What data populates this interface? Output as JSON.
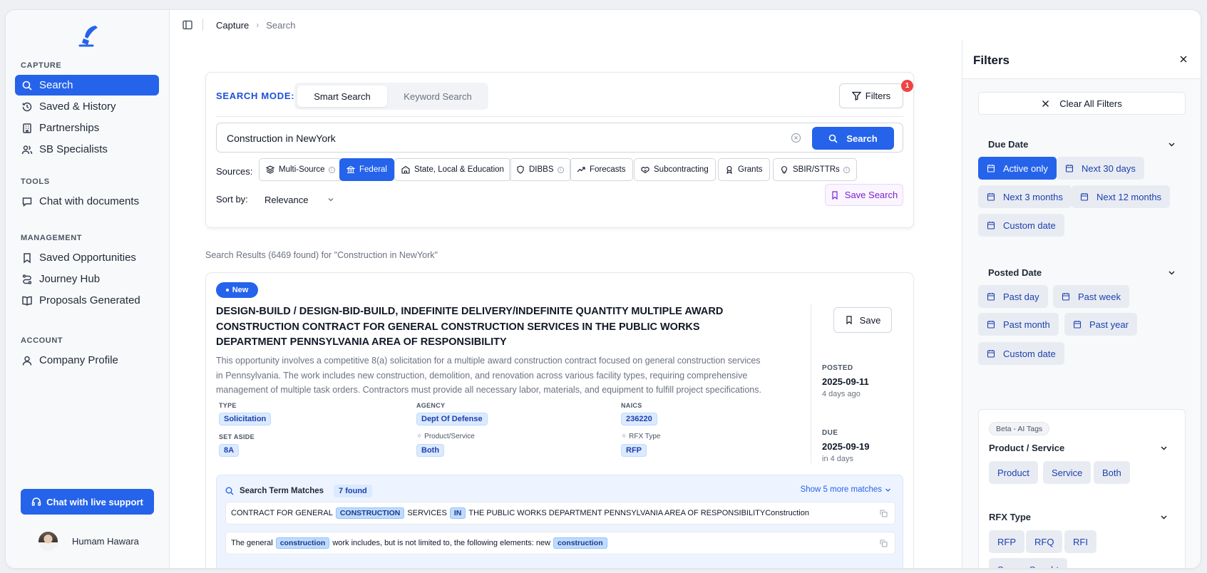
{
  "sidebar": {
    "sections": [
      {
        "title": "CAPTURE",
        "items": [
          "Search",
          "Saved & History",
          "Partnerships",
          "SB Specialists"
        ]
      },
      {
        "title": "TOOLS",
        "items": [
          "Chat with documents"
        ]
      },
      {
        "title": "MANAGEMENT",
        "items": [
          "Saved Opportunities",
          "Journey Hub",
          "Proposals Generated"
        ]
      },
      {
        "title": "ACCOUNT",
        "items": [
          "Company Profile"
        ]
      }
    ],
    "support_label": "Chat with live support",
    "user_name": "Humam Hawara"
  },
  "breadcrumb": {
    "root": "Capture",
    "current": "Search"
  },
  "search_card": {
    "mode_label": "SEARCH MODE:",
    "modes": [
      "Smart Search",
      "Keyword Search"
    ],
    "active_mode": "Smart Search",
    "filters_label": "Filters",
    "filters_count": "1",
    "query": "Construction in NewYork",
    "search_button": "Search",
    "sources_label": "Sources:",
    "sources": [
      "Multi-Source",
      "Federal",
      "State, Local & Education",
      "DIBBS",
      "Forecasts",
      "Subcontracting",
      "Grants",
      "SBIR/STTRs"
    ],
    "selected_source": "Federal",
    "sort_label": "Sort by:",
    "sort_value": "Relevance",
    "save_search_label": "Save Search"
  },
  "results": {
    "summary": "Search Results (6469 found) for \"Construction in NewYork\"",
    "items": [
      {
        "badge": "New",
        "title": "DESIGN-BUILD / DESIGN-BID-BUILD, INDEFINITE DELIVERY/INDEFINITE QUANTITY MULTIPLE AWARD CONSTRUCTION CONTRACT FOR GENERAL CONSTRUCTION SERVICES IN THE PUBLIC WORKS DEPARTMENT PENNSYLVANIA AREA OF RESPONSIBILITY",
        "description": "This opportunity involves a competitive 8(a) solicitation for a multiple award construction contract focused on general construction services in Pennsylvania. The work includes new construction, demolition, and renovation across various facility types, requiring comprehensive management of multiple task orders. Contractors must provide all necessary labor, materials, and equipment to fulfill project specifications.",
        "meta": {
          "type_label": "TYPE",
          "type": "Solicitation",
          "agency_label": "AGENCY",
          "agency": "Dept Of Defense",
          "naics_label": "NAICS",
          "naics": "236220",
          "set_aside_label": "SET ASIDE",
          "set_aside": "8A",
          "product_label": "Product/Service",
          "product": "Both",
          "rfx_label": "RFX Type",
          "rfx": "RFP"
        },
        "save_label": "Save",
        "posted_label": "POSTED",
        "posted_date": "2025-09-11",
        "posted_rel": "4 days ago",
        "due_label": "DUE",
        "due_date": "2025-09-19",
        "due_rel": "in 4 days",
        "matches": {
          "title": "Search Term Matches",
          "found": "7 found",
          "show_more": "Show 5 more matches",
          "row1": {
            "t1": "CONTRACT FOR GENERAL",
            "h1": "CONSTRUCTION",
            "t2": "SERVICES",
            "h2": "IN",
            "t3": "THE PUBLIC WORKS DEPARTMENT PENNSYLVANIA AREA OF RESPONSIBILITYConstruction"
          },
          "row2": {
            "t1": "The general",
            "h1": "construction",
            "t2": "work includes, but is not limited to, the following elements: new",
            "h2": "construction"
          }
        }
      }
    ]
  },
  "filters": {
    "title": "Filters",
    "clear_all": "Clear All Filters",
    "due_date": {
      "title": "Due Date",
      "options": [
        "Active only",
        "Next 30 days",
        "Next 3 months",
        "Next 12 months",
        "Custom date"
      ],
      "selected": "Active only"
    },
    "posted_date": {
      "title": "Posted Date",
      "options": [
        "Past day",
        "Past week",
        "Past month",
        "Past year",
        "Custom date"
      ]
    },
    "ai_tags": {
      "beta_label": "Beta - AI Tags",
      "product_service": {
        "title": "Product / Service",
        "options": [
          "Product",
          "Service",
          "Both"
        ]
      },
      "rfx_type": {
        "title": "RFX Type",
        "options": [
          "RFP",
          "RFQ",
          "RFI",
          "Source Sought"
        ]
      }
    }
  },
  "colors": {
    "accent": "#2563eb",
    "badge_red": "#ef4444",
    "tag_bg": "#dbeafe",
    "save_search": "#7e22ce"
  }
}
